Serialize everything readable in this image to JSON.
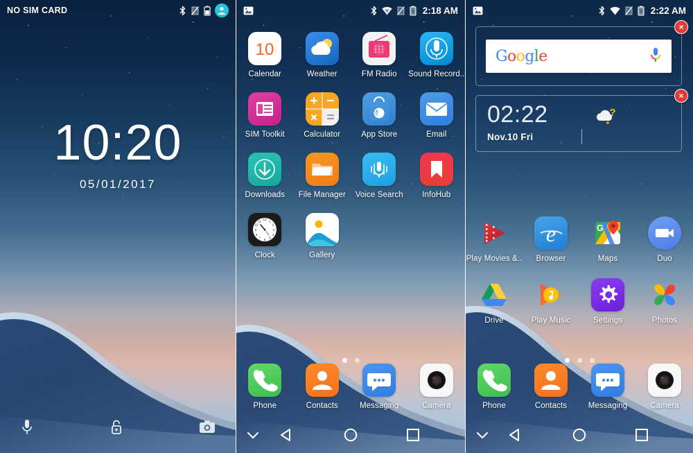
{
  "panels": [
    {
      "id": "lockscreen",
      "statusbar": {
        "carrier": "NO SIM CARD",
        "icons": [
          "bluetooth-icon",
          "no-sim-icon",
          "battery-icon",
          "account-avatar-icon"
        ]
      },
      "clock": {
        "time": "10:20",
        "date": "05/01/2017"
      },
      "bottom_shortcuts": [
        {
          "name": "voice-assistant-icon",
          "label": ""
        },
        {
          "name": "unlock-icon",
          "label": ""
        },
        {
          "name": "camera-icon",
          "label": ""
        }
      ]
    },
    {
      "id": "homescreen-page-1",
      "statusbar": {
        "left_icon": "photo-notification-icon",
        "icons": [
          "bluetooth-icon",
          "wifi-icon",
          "no-sim-icon",
          "battery-charging-icon"
        ],
        "time": "2:18 AM"
      },
      "page_dots": {
        "count": 2,
        "active": 1
      },
      "apps": [
        [
          {
            "label": "Calendar",
            "icon": "calendar-icon"
          },
          {
            "label": "Weather",
            "icon": "weather-icon"
          },
          {
            "label": "FM Radio",
            "icon": "fm-radio-icon"
          },
          {
            "label": "Sound Record..",
            "icon": "sound-recorder-icon"
          }
        ],
        [
          {
            "label": "SIM Toolkit",
            "icon": "sim-toolkit-icon"
          },
          {
            "label": "Calculator",
            "icon": "calculator-icon"
          },
          {
            "label": "App Store",
            "icon": "app-store-icon"
          },
          {
            "label": "Email",
            "icon": "email-icon"
          }
        ],
        [
          {
            "label": "Downloads",
            "icon": "downloads-icon"
          },
          {
            "label": "File Manager",
            "icon": "file-manager-icon"
          },
          {
            "label": "Voice Search",
            "icon": "voice-search-icon"
          },
          {
            "label": "InfoHub",
            "icon": "infohub-icon"
          }
        ],
        [
          {
            "label": "Clock",
            "icon": "clock-icon"
          },
          {
            "label": "Gallery",
            "icon": "gallery-icon"
          },
          {
            "label": "",
            "icon": ""
          },
          {
            "label": "",
            "icon": ""
          }
        ]
      ],
      "dock": [
        {
          "label": "Phone",
          "icon": "phone-icon"
        },
        {
          "label": "Contacts",
          "icon": "contacts-icon"
        },
        {
          "label": "Messaging",
          "icon": "messaging-icon"
        },
        {
          "label": "Camera",
          "icon": "camera-app-icon"
        }
      ],
      "navbar": [
        "chevron-down-icon",
        "back-icon",
        "home-icon",
        "recents-icon"
      ]
    },
    {
      "id": "homescreen-page-2",
      "statusbar": {
        "left_icon": "photo-notification-icon",
        "icons": [
          "bluetooth-icon",
          "wifi-icon",
          "no-sim-icon",
          "battery-charging-icon"
        ],
        "time": "2:22 AM"
      },
      "page_dots": {
        "count": 3,
        "active": 1
      },
      "search_widget": {
        "logo_text": "Google",
        "logo_letters": [
          {
            "ch": "G",
            "color": "#4285F4"
          },
          {
            "ch": "o",
            "color": "#EA4335"
          },
          {
            "ch": "o",
            "color": "#FBBC05"
          },
          {
            "ch": "g",
            "color": "#4285F4"
          },
          {
            "ch": "l",
            "color": "#34A853"
          },
          {
            "ch": "e",
            "color": "#EA4335"
          }
        ],
        "mic_icon": "google-mic-icon",
        "close_label": "×"
      },
      "clock_widget": {
        "time": "02:22",
        "date": "Nov.10 Fri",
        "weather_icon": "cloud-unknown-weather-icon",
        "close_label": "×"
      },
      "apps": [
        [
          {
            "label": "Play Movies &..",
            "icon": "play-movies-icon"
          },
          {
            "label": "Browser",
            "icon": "browser-icon"
          },
          {
            "label": "Maps",
            "icon": "maps-icon"
          },
          {
            "label": "Duo",
            "icon": "duo-icon"
          }
        ],
        [
          {
            "label": "Drive",
            "icon": "drive-icon"
          },
          {
            "label": "Play Music",
            "icon": "play-music-icon"
          },
          {
            "label": "Settings",
            "icon": "settings-icon"
          },
          {
            "label": "Photos",
            "icon": "photos-icon"
          }
        ]
      ],
      "dock": [
        {
          "label": "Phone",
          "icon": "phone-icon"
        },
        {
          "label": "Contacts",
          "icon": "contacts-icon"
        },
        {
          "label": "Messaging",
          "icon": "messaging-icon"
        },
        {
          "label": "Camera",
          "icon": "camera-app-icon"
        }
      ],
      "navbar": [
        "chevron-down-icon",
        "back-icon",
        "home-icon",
        "recents-icon"
      ]
    }
  ],
  "colors": {
    "sky_top": "#0d2847",
    "sky_sunset": "#e0bdb0",
    "dune": "#2c4a74",
    "accent_red": "#e53935",
    "status_text": "#ffffff"
  }
}
